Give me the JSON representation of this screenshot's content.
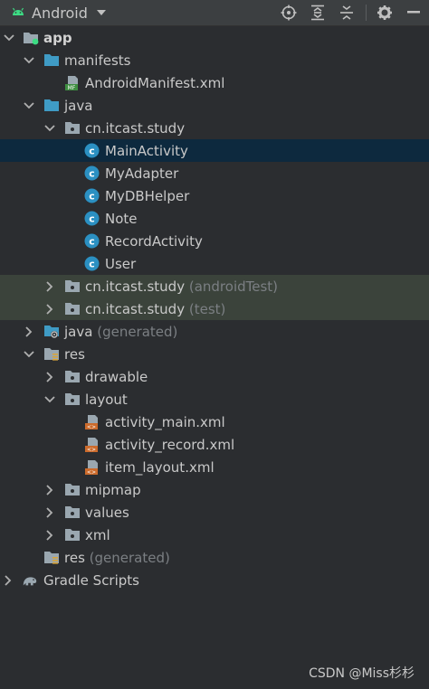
{
  "toolbar": {
    "title": "Android",
    "icons": [
      "android-icon",
      "dropdown-caret-icon",
      "locate-icon",
      "expand-all-icon",
      "collapse-all-icon",
      "settings-gear-icon",
      "hide-icon"
    ]
  },
  "tree": [
    {
      "label": "app",
      "suffix": "",
      "bold": true,
      "expanded": true,
      "icon": "module-folder-icon"
    },
    {
      "label": "manifests",
      "suffix": "",
      "expanded": true,
      "icon": "folder-icon"
    },
    {
      "label": "AndroidManifest.xml",
      "suffix": "",
      "icon": "manifest-file-icon"
    },
    {
      "label": "java",
      "suffix": "",
      "expanded": true,
      "icon": "folder-icon"
    },
    {
      "label": "cn.itcast.study",
      "suffix": "",
      "expanded": true,
      "icon": "package-icon"
    },
    {
      "label": "MainActivity",
      "suffix": "",
      "icon": "class-icon",
      "selected": true
    },
    {
      "label": "MyAdapter",
      "suffix": "",
      "icon": "class-icon"
    },
    {
      "label": "MyDBHelper",
      "suffix": "",
      "icon": "class-icon"
    },
    {
      "label": "Note",
      "suffix": "",
      "icon": "class-icon"
    },
    {
      "label": "RecordActivity",
      "suffix": "",
      "icon": "class-icon"
    },
    {
      "label": "User",
      "suffix": "",
      "icon": "class-icon"
    },
    {
      "label": "cn.itcast.study",
      "suffix": "(androidTest)",
      "expanded": false,
      "icon": "package-icon",
      "highlighted": true
    },
    {
      "label": "cn.itcast.study",
      "suffix": "(test)",
      "expanded": false,
      "icon": "package-icon",
      "highlighted": true
    },
    {
      "label": "java",
      "suffix": "(generated)",
      "expanded": false,
      "icon": "generated-folder-icon"
    },
    {
      "label": "res",
      "suffix": "",
      "expanded": true,
      "icon": "resources-folder-icon"
    },
    {
      "label": "drawable",
      "suffix": "",
      "expanded": false,
      "icon": "package-icon"
    },
    {
      "label": "layout",
      "suffix": "",
      "expanded": true,
      "icon": "package-icon"
    },
    {
      "label": "activity_main.xml",
      "suffix": "",
      "icon": "layout-file-icon"
    },
    {
      "label": "activity_record.xml",
      "suffix": "",
      "icon": "layout-file-icon"
    },
    {
      "label": "item_layout.xml",
      "suffix": "",
      "icon": "layout-file-icon"
    },
    {
      "label": "mipmap",
      "suffix": "",
      "expanded": false,
      "icon": "package-icon"
    },
    {
      "label": "values",
      "suffix": "",
      "expanded": false,
      "icon": "package-icon"
    },
    {
      "label": "xml",
      "suffix": "",
      "expanded": false,
      "icon": "package-icon"
    },
    {
      "label": "res",
      "suffix": "(generated)",
      "icon": "resources-folder-icon"
    },
    {
      "label": "Gradle Scripts",
      "suffix": "",
      "expanded": false,
      "icon": "gradle-icon"
    }
  ],
  "watermark": "CSDN @Miss杉杉",
  "colors": {
    "background": "#2b2d30",
    "selection": "#0d293e",
    "highlight": "#3b433b",
    "folder_blue": "#3f9bc5",
    "class_teal": "#2b90c2",
    "android_green": "#3ddc84"
  }
}
